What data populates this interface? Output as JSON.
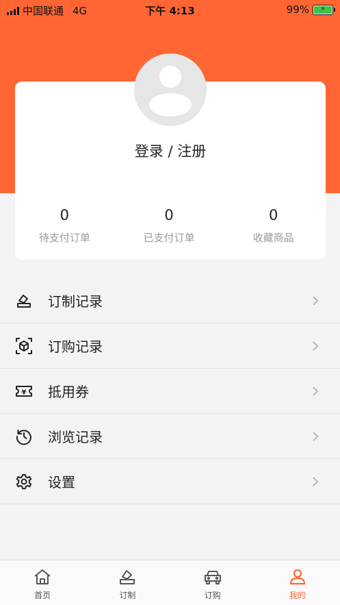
{
  "status_bar": {
    "carrier": "中国联通",
    "network": "4G",
    "time": "下午 4:13",
    "battery": "99%"
  },
  "profile": {
    "login_label": "登录 / 注册"
  },
  "stats": [
    {
      "value": "0",
      "label": "待支付订单"
    },
    {
      "value": "0",
      "label": "已支付订单"
    },
    {
      "value": "0",
      "label": "收藏商品"
    }
  ],
  "menu": [
    {
      "label": "订制记录",
      "icon": "customize-icon"
    },
    {
      "label": "订购记录",
      "icon": "box-icon"
    },
    {
      "label": "抵用券",
      "icon": "coupon-icon"
    },
    {
      "label": "浏览记录",
      "icon": "history-icon"
    },
    {
      "label": "设置",
      "icon": "gear-icon"
    }
  ],
  "tabbar": [
    {
      "label": "首页",
      "icon": "home-icon",
      "active": false
    },
    {
      "label": "订制",
      "icon": "customize-icon",
      "active": false
    },
    {
      "label": "订购",
      "icon": "car-icon",
      "active": false
    },
    {
      "label": "我的",
      "icon": "person-icon",
      "active": true
    }
  ],
  "colors": {
    "accent": "#ff6633",
    "background": "#f3f3f5",
    "battery": "#3ec04a"
  }
}
